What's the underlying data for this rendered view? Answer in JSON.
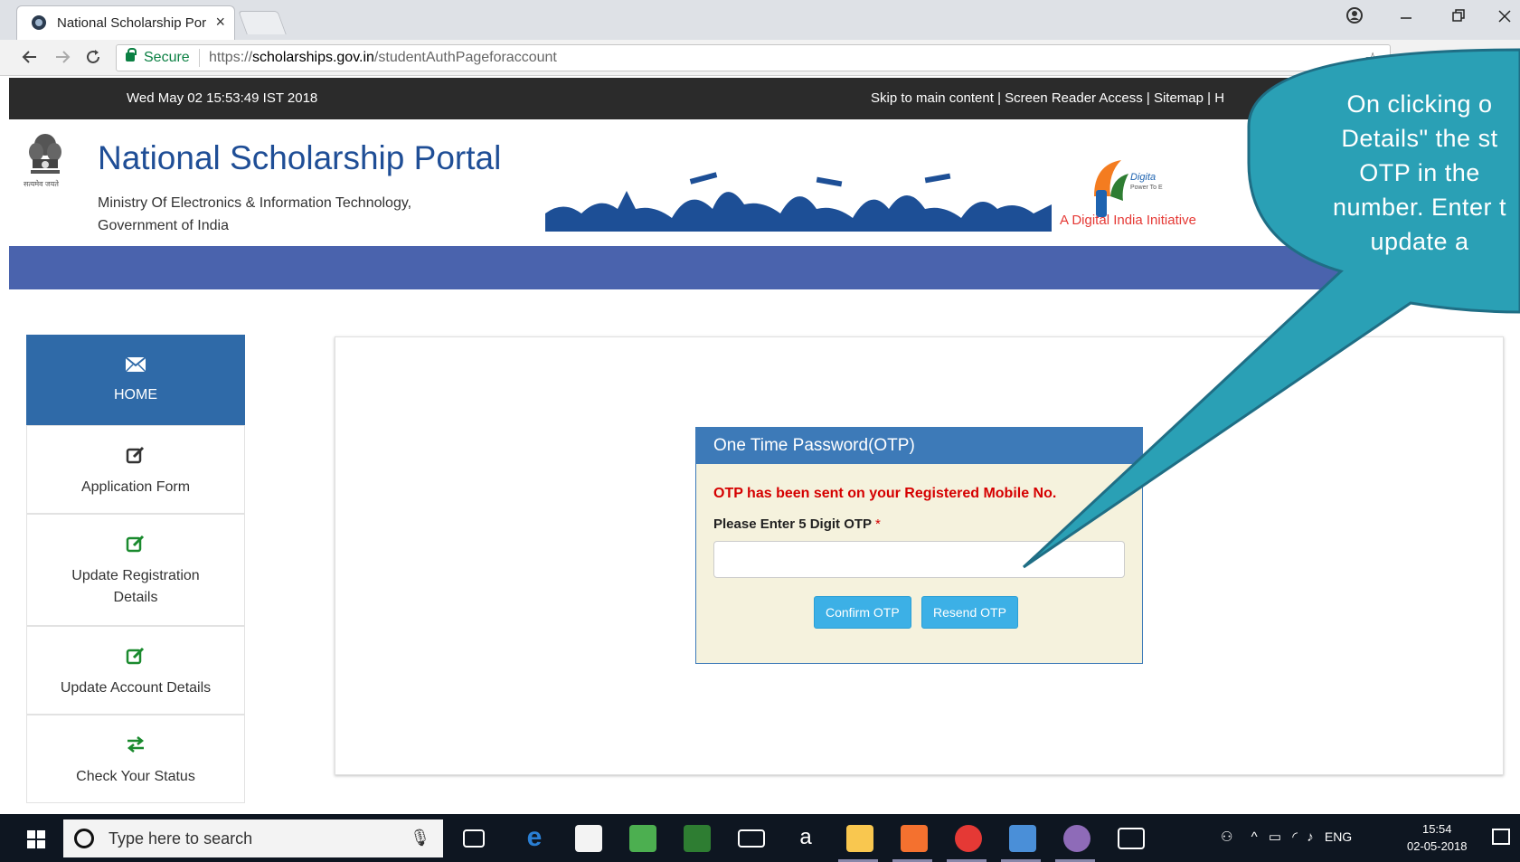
{
  "browser": {
    "tab_title": "National Scholarship Por",
    "tab_close": "×",
    "secure_label": "Secure",
    "url_scheme": "https://",
    "url_host": "scholarships.gov.in",
    "url_path": "/studentAuthPageforaccount"
  },
  "topbar": {
    "datetime": "Wed May 02 15:53:49 IST 2018",
    "links": "Skip to main content | Screen Reader Access | Sitemap | H"
  },
  "header": {
    "title": "National Scholarship Portal",
    "ministry_line1": "Ministry Of Electronics & Information Technology,",
    "ministry_line2": "Government of India",
    "emblem_caption": "सत्यमेव जयते",
    "digital_india_small": "Digita",
    "digital_india_tagline": "Power To E",
    "digital_india_text": "A Digital India Initiative"
  },
  "sidebar": {
    "items": [
      {
        "label": "HOME",
        "icon": "envelope-icon"
      },
      {
        "label": "Application Form",
        "icon": "edit-icon"
      },
      {
        "label_line1": "Update Registration",
        "label_line2": "Details",
        "icon": "edit-icon"
      },
      {
        "label": "Update Account Details",
        "icon": "edit-icon"
      },
      {
        "label": "Check Your Status",
        "icon": "exchange-icon"
      }
    ]
  },
  "otp": {
    "heading": "One Time Password(OTP)",
    "message": "OTP has been sent on your Registered Mobile No.",
    "label": "Please Enter 5 Digit OTP",
    "required_mark": "*",
    "input_value": "",
    "confirm_label": "Confirm OTP",
    "resend_label": "Resend OTP"
  },
  "callout": {
    "line1": "On clicking o",
    "line2": "Details\" the st",
    "line3": "OTP in the",
    "line4": "number. Enter t",
    "line5": "update a"
  },
  "taskbar": {
    "search_placeholder": "Type here to search",
    "lang": "ENG",
    "time": "15:54",
    "date": "02-05-2018"
  },
  "colors": {
    "site_blue": "#4a63ad",
    "title_blue": "#1f4e96",
    "panel_header": "#3d7ab8",
    "button": "#3cb0e6",
    "callout": "#2aa0b5",
    "error_red": "#d50000"
  }
}
